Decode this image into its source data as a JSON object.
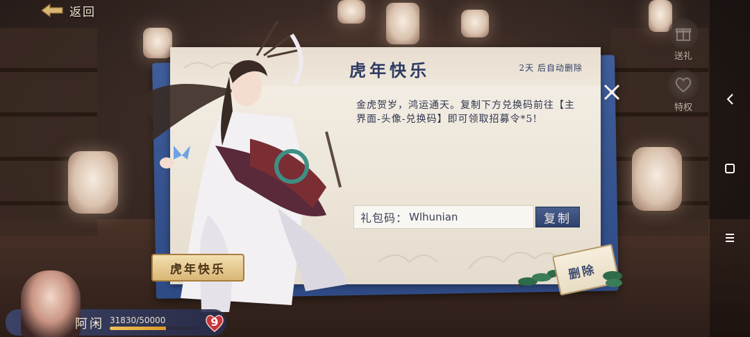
{
  "topbar": {
    "back_label": "返回"
  },
  "side_icons": {
    "gift_label": "送礼",
    "privilege_label": "特权"
  },
  "mail": {
    "title": "虎年快乐",
    "expire_days": "2天",
    "expire_suffix": "后自动删除",
    "body": "金虎贺岁，鸿运通天。复制下方兑换码前往【主界面-头像-兑换码】即可领取招募令*5!",
    "code_label": "礼包码：",
    "code_value": "Wlhunian",
    "copy_label": "复制",
    "delete_label": "删除",
    "ribbon_label": "虎年快乐"
  },
  "player": {
    "name": "阿闲",
    "stamina_text": "31830/50000",
    "stamina_fraction": 0.6366,
    "heart_count": "9"
  },
  "colors": {
    "panel_blue": "#2f4b86",
    "title_ink": "#2c3a63",
    "copy_button": "#2f426e",
    "stamina_gold": "#f0c45a",
    "heart_red": "#c8343a"
  }
}
